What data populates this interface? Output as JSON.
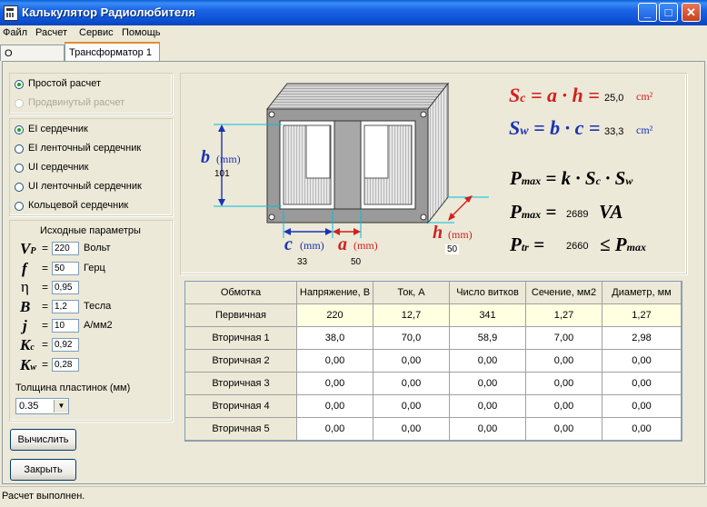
{
  "window": {
    "title": "Калькулятор Радиолюбителя"
  },
  "menu": [
    "Файл",
    "Расчет",
    "Сервис",
    "Помощь"
  ],
  "tabs": [
    "О программе",
    "Трансформатор 1"
  ],
  "calc_mode": {
    "options": [
      "Простой расчет",
      "Продвинутый расчет"
    ],
    "selected": "Простой расчет"
  },
  "core_type": {
    "options": [
      "EI сердечник",
      "EI ленточный сердечник",
      "UI сердечник",
      "UI ленточный сердечник",
      "Кольцевой сердечник"
    ],
    "selected": "EI сердечник"
  },
  "params": {
    "title": "Исходные параметры",
    "vp": {
      "sym": "V",
      "sub": "P",
      "value": "220",
      "unit": "Вольт"
    },
    "f": {
      "sym": "f",
      "value": "50",
      "unit": "Герц"
    },
    "eta": {
      "sym": "η",
      "value": "0,95"
    },
    "b": {
      "sym": "B",
      "value": "1,2",
      "unit": "Тесла"
    },
    "j": {
      "sym": "j",
      "value": "10",
      "unit": "A/мм2"
    },
    "kc": {
      "sym": "K",
      "sub": "c",
      "value": "0,92"
    },
    "kw": {
      "sym": "K",
      "sub": "w",
      "value": "0,28"
    }
  },
  "thickness": {
    "label": "Толщина пластинок (мм)",
    "value": "0.35"
  },
  "buttons": {
    "calculate": "Вычислить",
    "close": "Закрыть"
  },
  "diagram": {
    "b": {
      "label": "b",
      "unit": "(mm)",
      "value": "101"
    },
    "c": {
      "label": "c",
      "unit": "(mm)",
      "value": "33"
    },
    "a": {
      "label": "a",
      "unit": "(mm)",
      "value": "50"
    },
    "h": {
      "label": "h",
      "unit": "(mm)",
      "value": "50"
    }
  },
  "formulas": {
    "sc": {
      "lhs": "S",
      "lhs_sub": "c",
      "rhs": "= a · h =",
      "value": "25,0",
      "unit": "cm²"
    },
    "sw": {
      "lhs": "S",
      "lhs_sub": "w",
      "rhs": "= b · c =",
      "value": "33,3",
      "unit": "cm²"
    },
    "pmax_def": {
      "lhs": "P",
      "lhs_sub": "max",
      "rhs": "= k · S",
      "rhs_sub": "c",
      "rhs2": " · S",
      "rhs2_sub": "w"
    },
    "pmax_val": {
      "lhs": "P",
      "lhs_sub": "max",
      "eq": "=",
      "value": "2689",
      "unit": "VA"
    },
    "ptr": {
      "lhs": "P",
      "lhs_sub": "tr",
      "eq": "=",
      "value": "2660",
      "rel": "≤ P",
      "rel_sub": "max"
    }
  },
  "colors": {
    "sc": "#d21f1f",
    "sw": "#1a32b4",
    "dim_b": "#1a32b4",
    "dim_a": "#d21f1f",
    "dim_h": "#d21f1f",
    "cyan_guide": "#00c0e0"
  },
  "table": {
    "headers": [
      "Обмотка",
      "Напряжение, В",
      "Ток, А",
      "Число витков",
      "Сечение, мм2",
      "Диаметр, мм"
    ],
    "rows": [
      [
        "Первичная",
        "220",
        "12,7",
        "341",
        "1,27",
        "1,27"
      ],
      [
        "Вторичная 1",
        "38,0",
        "70,0",
        "58,9",
        "7,00",
        "2,98"
      ],
      [
        "Вторичная 2",
        "0,00",
        "0,00",
        "0,00",
        "0,00",
        "0,00"
      ],
      [
        "Вторичная 3",
        "0,00",
        "0,00",
        "0,00",
        "0,00",
        "0,00"
      ],
      [
        "Вторичная 4",
        "0,00",
        "0,00",
        "0,00",
        "0,00",
        "0,00"
      ],
      [
        "Вторичная 5",
        "0,00",
        "0,00",
        "0,00",
        "0,00",
        "0,00"
      ]
    ]
  },
  "status": "Расчет выполнен."
}
